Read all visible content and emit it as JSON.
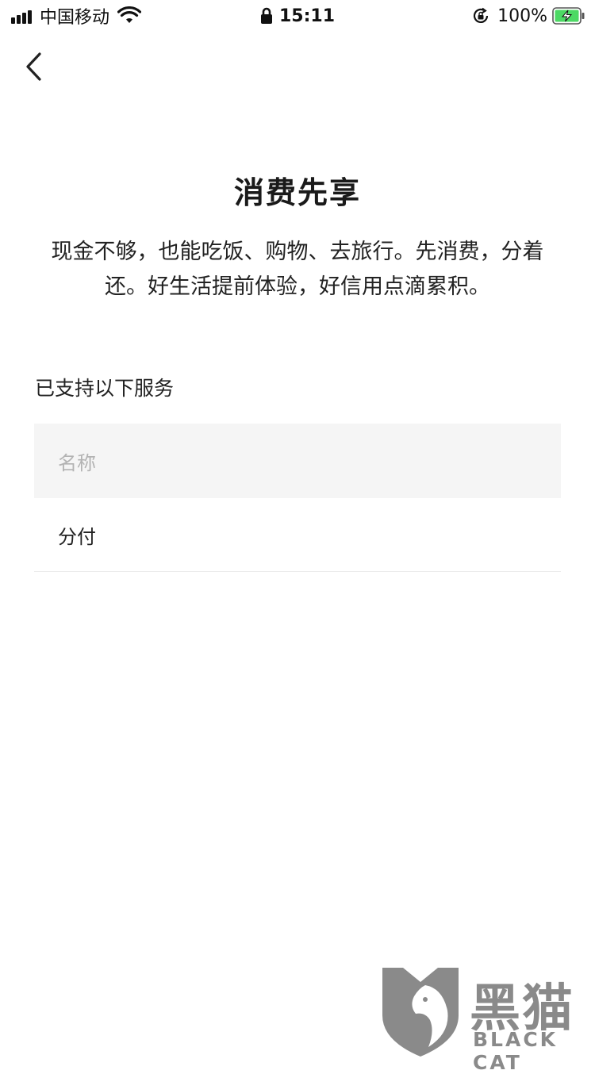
{
  "status_bar": {
    "carrier": "中国移动",
    "time": "15:11",
    "battery": "100%"
  },
  "page": {
    "title": "消费先享",
    "description": "现金不够，也能吃饭、购物、去旅行。先消费，分着还。好生活提前体验，好信用点滴累积。"
  },
  "services": {
    "label": "已支持以下服务",
    "header": "名称",
    "rows": [
      "分付"
    ]
  },
  "watermark": {
    "name_cn": "黑猫",
    "name_en": "BLACK CAT"
  },
  "colors": {
    "battery_green": "#4cd964",
    "header_bg": "#f5f5f5",
    "watermark_gray": "#8a8a8a"
  }
}
